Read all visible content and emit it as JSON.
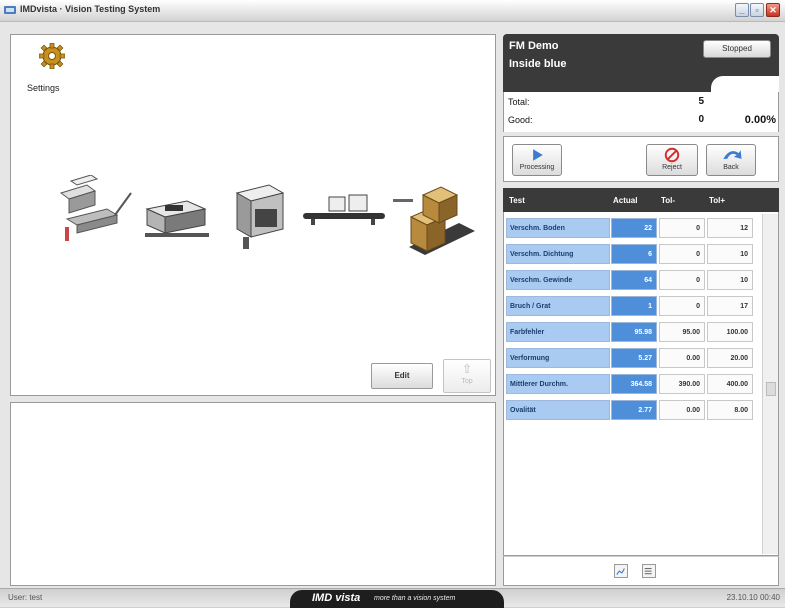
{
  "window": {
    "title": "IMDvista · Vision Testing System",
    "buttons": [
      "minimize",
      "maximize",
      "close"
    ]
  },
  "settings": {
    "label": "Settings",
    "icon": "gear-icon"
  },
  "line_machines": [
    "feeder-machine",
    "packaging-machine",
    "filling-machine",
    "conveyor-machine",
    "palletizer-machine"
  ],
  "controls": {
    "edit_label": "Edit",
    "top_label": "Top"
  },
  "header": {
    "job": "FM Demo",
    "product": "Inside blue",
    "status": "Stopped"
  },
  "counts": {
    "total_label": "Total:",
    "total": "5",
    "good_label": "Good:",
    "good": "0",
    "good_percent": "0.00%"
  },
  "actions": {
    "processing": "Processing",
    "reject": "Reject",
    "back": "Back"
  },
  "table": {
    "headers": {
      "test": "Test",
      "actual": "Actual",
      "tol_minus": "Tol-",
      "tol_plus": "Tol+"
    },
    "rows": [
      {
        "name": "Verschm. Boden",
        "actual": "22",
        "tol_minus": "0",
        "tol_plus": "12"
      },
      {
        "name": "Verschm. Dichtung",
        "actual": "6",
        "tol_minus": "0",
        "tol_plus": "10"
      },
      {
        "name": "Verschm. Gewinde",
        "actual": "64",
        "tol_minus": "0",
        "tol_plus": "10"
      },
      {
        "name": "Bruch / Grat",
        "actual": "1",
        "tol_minus": "0",
        "tol_plus": "17"
      },
      {
        "name": "Farbfehler",
        "actual": "95.98",
        "tol_minus": "95.00",
        "tol_plus": "100.00"
      },
      {
        "name": "Verformung",
        "actual": "5.27",
        "tol_minus": "0.00",
        "tol_plus": "20.00"
      },
      {
        "name": "Mittlerer Durchm.",
        "actual": "364.58",
        "tol_minus": "390.00",
        "tol_plus": "400.00"
      },
      {
        "name": "Ovalität",
        "actual": "2.77",
        "tol_minus": "0.00",
        "tol_plus": "8.00"
      }
    ]
  },
  "statusbar": {
    "user": "User: test",
    "brand": "IMD vista",
    "tagline": "more than a vision system",
    "clock": "23.10.10 00:40"
  },
  "colors": {
    "dark_header": "#3a3a3a",
    "name_cell": "#a9cbf1",
    "actual_cell": "#4f8fda",
    "reject_red": "#d62c2c",
    "back_blue": "#3b7bd0"
  }
}
